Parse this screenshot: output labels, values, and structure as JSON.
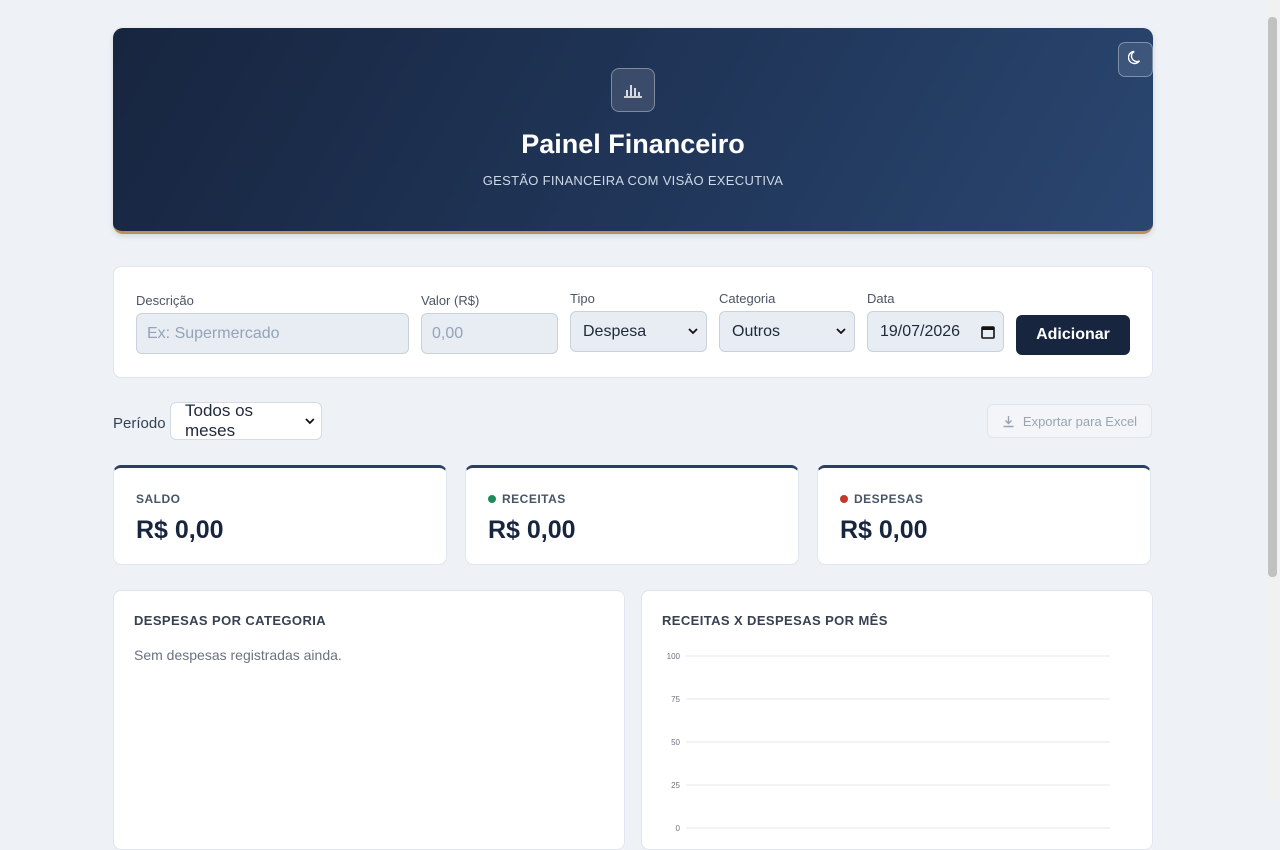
{
  "header": {
    "title": "Painel Financeiro",
    "subtitle": "GESTÃO FINANCEIRA COM VISÃO EXECUTIVA",
    "logo_icon": "bar-chart-icon",
    "theme_icon": "moon-icon"
  },
  "form": {
    "description_label": "Descrição",
    "description_placeholder": "Ex: Supermercado",
    "value_label": "Valor (R$)",
    "value_placeholder": "0,00",
    "type_label": "Tipo",
    "type_value": "Despesa",
    "category_label": "Categoria",
    "category_value": "Outros",
    "date_label": "Data",
    "date_value": "19/07/2026",
    "add_button": "Adicionar"
  },
  "filters": {
    "period_label": "Período",
    "period_value": "Todos os meses",
    "export_button": "Exportar para Excel"
  },
  "kpis": [
    {
      "label": "SALDO",
      "value": "R$ 0,00"
    },
    {
      "label": "RECEITAS",
      "value": "R$ 0,00",
      "dot_color": "#1f8a5b"
    },
    {
      "label": "DESPESAS",
      "value": "R$ 0,00",
      "dot_color": "#c0392b"
    }
  ],
  "panels": {
    "category_title": "DESPESAS POR CATEGORIA",
    "category_empty": "Sem despesas registradas ainda.",
    "monthly_title": "RECEITAS X DESPESAS POR MÊS"
  },
  "chart_data": {
    "type": "bar",
    "title": "RECEITAS X DESPESAS POR MÊS",
    "ylim": [
      0,
      100
    ],
    "yticks": [
      "100",
      "75",
      "50",
      "25",
      "0"
    ],
    "grid": true
  },
  "colors": {
    "accent": "#17253f",
    "gold": "#b8925a",
    "income": "#1f8a5b",
    "expense": "#c0392b"
  }
}
